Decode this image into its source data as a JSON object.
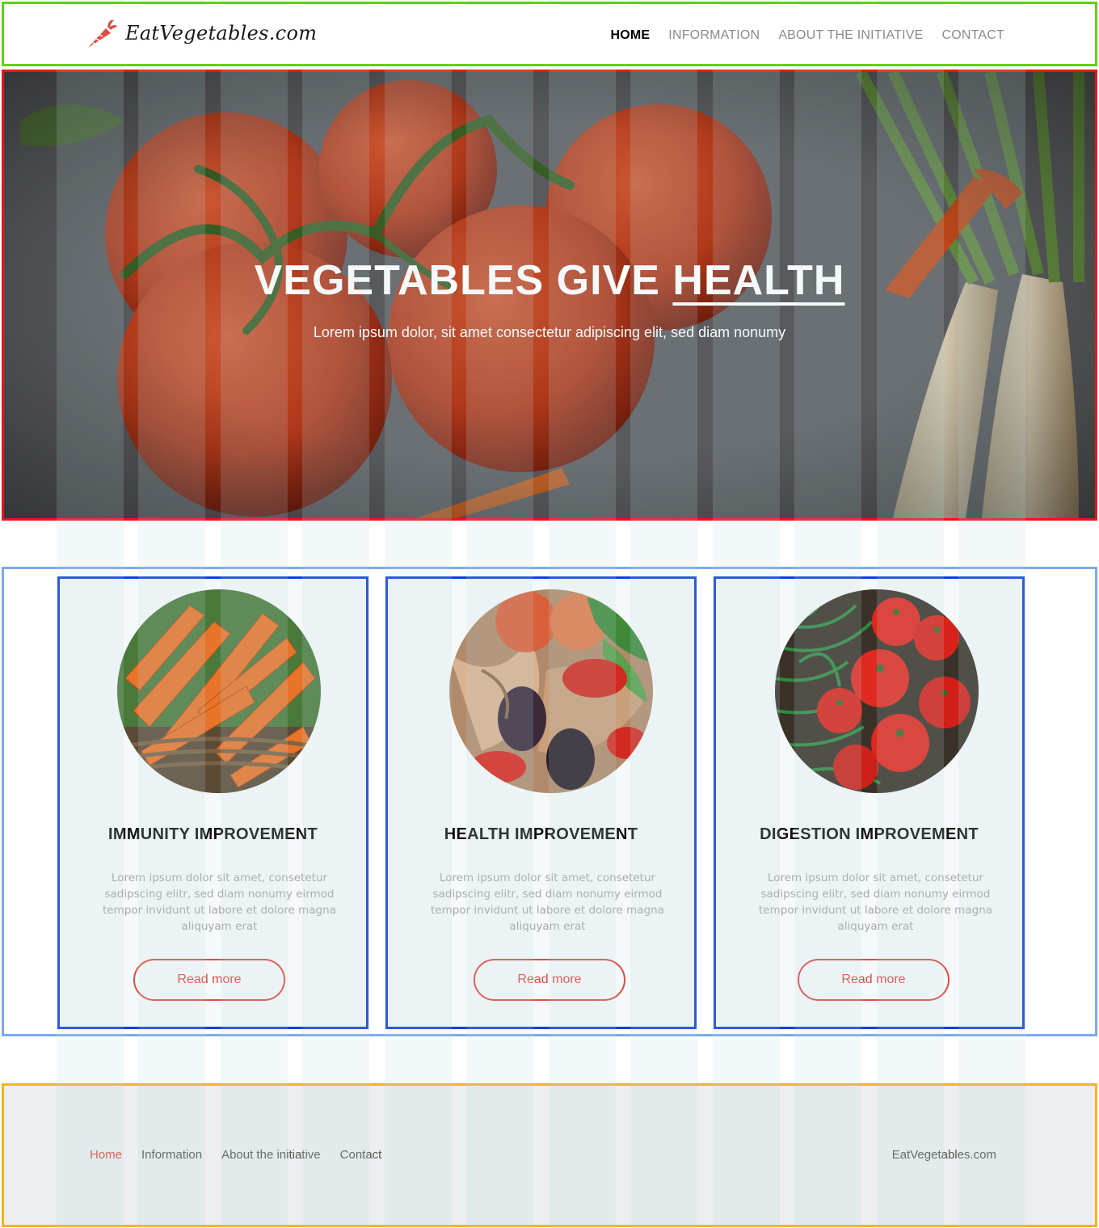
{
  "header": {
    "logo_text": "EatVegetables.com",
    "nav": [
      {
        "label": "HOME",
        "active": true
      },
      {
        "label": "INFORMATION",
        "active": false
      },
      {
        "label": "ABOUT THE INITIATIVE",
        "active": false
      },
      {
        "label": "CONTACT",
        "active": false
      }
    ]
  },
  "hero": {
    "title_main": "VEGETABLES GIVE ",
    "title_highlight": "HEALTH",
    "subtitle": "Lorem ipsum dolor, sit amet consectetur adipiscing elit, sed diam nonumy"
  },
  "features": {
    "cards": [
      {
        "title": "IMMUNITY IMPROVEMENT",
        "text": "Lorem ipsum dolor sit amet, consetetur sadipscing elitr, sed diam nonumy eirmod tempor invidunt ut labore et dolore magna aliquyam erat",
        "button": "Read more",
        "image": "carrots-in-basket"
      },
      {
        "title": "HEALTH IMPROVEMENT",
        "text": "Lorem ipsum dolor sit amet, consetetur sadipscing elitr, sed diam nonumy eirmod tempor invidunt ut labore et dolore magna aliquyam erat",
        "button": "Read more",
        "image": "mixed-vegetables-in-paper"
      },
      {
        "title": "DIGESTION IMPROVEMENT",
        "text": "Lorem ipsum dolor sit amet, consetetur sadipscing elitr, sed diam nonumy eirmod tempor invidunt ut labore et dolore magna aliquyam erat",
        "button": "Read more",
        "image": "tomatoes-with-greens"
      }
    ]
  },
  "footer": {
    "links": [
      {
        "label": "Home",
        "active": true
      },
      {
        "label": "Information",
        "active": false
      },
      {
        "label": "About the initiative",
        "active": false
      },
      {
        "label": "Contact",
        "active": false
      }
    ],
    "brand": "EatVegetables.com"
  },
  "colors": {
    "accent": "#e24b42",
    "header_outline": "#5fd314",
    "hero_outline": "#e8141c",
    "features_outline": "#7aabf0",
    "card_outline": "#0c3fe6",
    "footer_outline": "#eeb81c"
  }
}
